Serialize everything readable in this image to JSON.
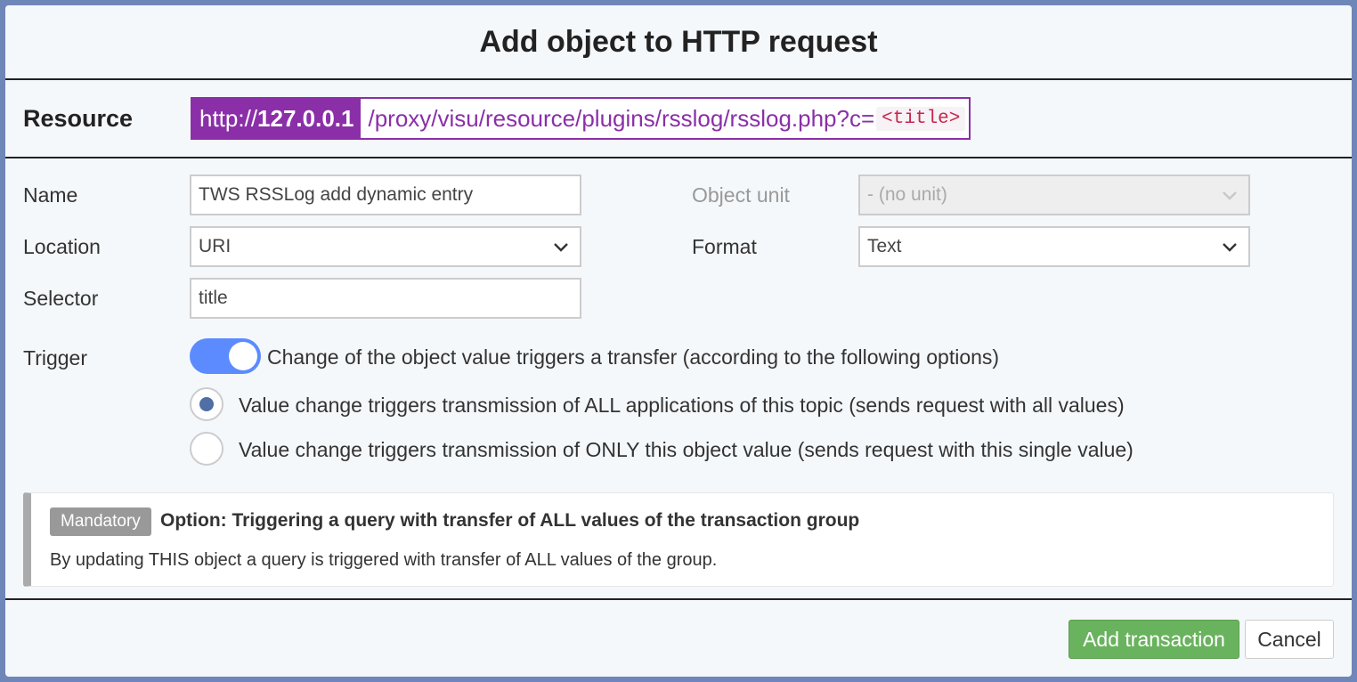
{
  "dialog": {
    "title": "Add object to HTTP request"
  },
  "resource": {
    "label": "Resource",
    "scheme": "http://",
    "host": "127.0.0.1",
    "path": "/proxy/visu/resource/plugins/rsslog/rsslog.php?c=",
    "placeholder_code": "<title>"
  },
  "form": {
    "name_label": "Name",
    "name_value": "TWS RSSLog add dynamic entry",
    "location_label": "Location",
    "location_value": "URI",
    "selector_label": "Selector",
    "selector_value": "title",
    "object_unit_label": "Object unit",
    "object_unit_value": "- (no unit)",
    "format_label": "Format",
    "format_value": "Text",
    "trigger_label": "Trigger",
    "trigger_toggle_text": "Change of the object value triggers a transfer (according to the following options)",
    "trigger_enabled": true,
    "radio_all_text": "Value change triggers transmission of ALL applications of this topic (sends request with all values)",
    "radio_single_text": "Value change triggers transmission of ONLY this object value (sends request with this single value)",
    "selected_radio": "all"
  },
  "callout": {
    "badge": "Mandatory",
    "title": "Option: Triggering a query with transfer of ALL values of the transaction group",
    "text": "By updating THIS object a query is triggered with transfer of ALL values of the group."
  },
  "footer": {
    "add_label": "Add transaction",
    "cancel_label": "Cancel"
  },
  "colors": {
    "accent_purple": "#8b2fa8",
    "toggle_blue": "#5b8bff",
    "add_green": "#6ab35e"
  }
}
